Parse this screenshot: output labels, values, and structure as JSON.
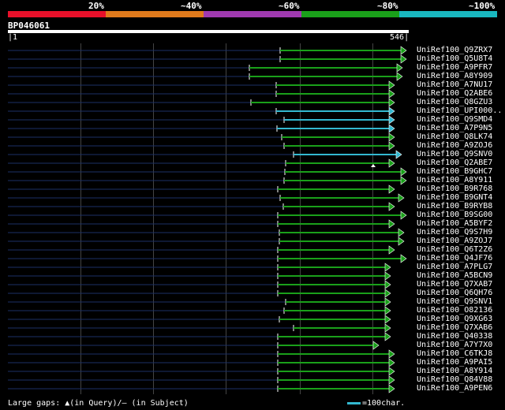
{
  "legend": {
    "labels": [
      "20%",
      "~40%",
      "~60%",
      "~80%",
      "~100%"
    ],
    "colors": [
      "#e8102a",
      "#e07a1c",
      "#a03ab0",
      "#1aa01a",
      "#19b8c0"
    ]
  },
  "query": {
    "id": "BP046061",
    "start_label": "1",
    "end_label": "546"
  },
  "hits": [
    {
      "name": "UniRef100_Q9ZRX7",
      "start": 355,
      "end": 515,
      "color": "#1aa01a"
    },
    {
      "name": "UniRef100_Q5U8T4",
      "start": 355,
      "end": 515,
      "color": "#1aa01a"
    },
    {
      "name": "UniRef100_A9PFR7",
      "start": 316,
      "end": 510,
      "color": "#1aa01a"
    },
    {
      "name": "UniRef100_A8Y909",
      "start": 316,
      "end": 510,
      "color": "#1aa01a"
    },
    {
      "name": "UniRef100_A7NU17",
      "start": 350,
      "end": 500,
      "color": "#1aa01a"
    },
    {
      "name": "UniRef100_Q2ABE6",
      "start": 350,
      "end": 500,
      "color": "#1aa01a"
    },
    {
      "name": "UniRef100_Q8GZU3",
      "start": 318,
      "end": 500,
      "color": "#1aa01a"
    },
    {
      "name": "UniRef100_UPI000..",
      "start": 350,
      "end": 500,
      "color": "#33b8d0"
    },
    {
      "name": "UniRef100_Q9SMD4",
      "start": 360,
      "end": 500,
      "color": "#33b8d0"
    },
    {
      "name": "UniRef100_A7P9N5",
      "start": 351,
      "end": 500,
      "color": "#33b8d0"
    },
    {
      "name": "UniRef100_Q8LK74",
      "start": 357,
      "end": 500,
      "color": "#1aa01a"
    },
    {
      "name": "UniRef100_A9ZOJ6",
      "start": 360,
      "end": 500,
      "color": "#1aa01a"
    },
    {
      "name": "UniRef100_Q9SNV0",
      "start": 372,
      "end": 509,
      "color": "#33b8d0"
    },
    {
      "name": "UniRef100_Q2ABE7",
      "start": 362,
      "end": 500,
      "color": "#1aa01a"
    },
    {
      "name": "UniRef100_B9GHC7",
      "start": 361,
      "end": 515,
      "color": "#1aa01a"
    },
    {
      "name": "UniRef100_A8Y911",
      "start": 360,
      "end": 515,
      "color": "#1aa01a"
    },
    {
      "name": "UniRef100_B9R768",
      "start": 352,
      "end": 500,
      "color": "#1aa01a"
    },
    {
      "name": "UniRef100_B9GNT4",
      "start": 355,
      "end": 512,
      "color": "#1aa01a"
    },
    {
      "name": "UniRef100_B9RYB8",
      "start": 359,
      "end": 500,
      "color": "#1aa01a"
    },
    {
      "name": "UniRef100_B9SG00",
      "start": 352,
      "end": 515,
      "color": "#1aa01a"
    },
    {
      "name": "UniRef100_A5BYF2",
      "start": 352,
      "end": 500,
      "color": "#1aa01a"
    },
    {
      "name": "UniRef100_Q9S7H9",
      "start": 354,
      "end": 512,
      "color": "#1aa01a"
    },
    {
      "name": "UniRef100_A9ZOJ7",
      "start": 354,
      "end": 512,
      "color": "#1aa01a"
    },
    {
      "name": "UniRef100_Q6T2Z6",
      "start": 352,
      "end": 500,
      "color": "#1aa01a"
    },
    {
      "name": "UniRef100_Q4JF76",
      "start": 352,
      "end": 515,
      "color": "#1aa01a"
    },
    {
      "name": "UniRef100_A7PLG7",
      "start": 352,
      "end": 495,
      "color": "#1aa01a"
    },
    {
      "name": "UniRef100_A5BCN9",
      "start": 352,
      "end": 495,
      "color": "#1aa01a"
    },
    {
      "name": "UniRef100_Q7XAB7",
      "start": 352,
      "end": 495,
      "color": "#1aa01a"
    },
    {
      "name": "UniRef100_Q6QH76",
      "start": 352,
      "end": 495,
      "color": "#1aa01a"
    },
    {
      "name": "UniRef100_Q9SNV1",
      "start": 362,
      "end": 495,
      "color": "#1aa01a"
    },
    {
      "name": "UniRef100_O82136",
      "start": 360,
      "end": 495,
      "color": "#1aa01a"
    },
    {
      "name": "UniRef100_Q9XG63",
      "start": 354,
      "end": 495,
      "color": "#1aa01a"
    },
    {
      "name": "UniRef100_Q7XAB6",
      "start": 372,
      "end": 495,
      "color": "#1aa01a"
    },
    {
      "name": "UniRef100_Q40338",
      "start": 352,
      "end": 495,
      "color": "#1aa01a"
    },
    {
      "name": "UniRef100_A7Y7X0",
      "start": 352,
      "end": 480,
      "color": "#1aa01a"
    },
    {
      "name": "UniRef100_C6TKJ8",
      "start": 352,
      "end": 500,
      "color": "#1aa01a"
    },
    {
      "name": "UniRef100_A9PAI5",
      "start": 352,
      "end": 500,
      "color": "#1aa01a"
    },
    {
      "name": "UniRef100_A8Y914",
      "start": 352,
      "end": 500,
      "color": "#1aa01a"
    },
    {
      "name": "UniRef100_Q84V88",
      "start": 352,
      "end": 500,
      "color": "#1aa01a"
    },
    {
      "name": "UniRef100_A9PEN6",
      "start": 352,
      "end": 500,
      "color": "#1aa01a"
    }
  ],
  "footer": {
    "gaps_text": "Large gaps: ▲(in Query)/— (in Subject)",
    "scale_text": "=100char."
  }
}
